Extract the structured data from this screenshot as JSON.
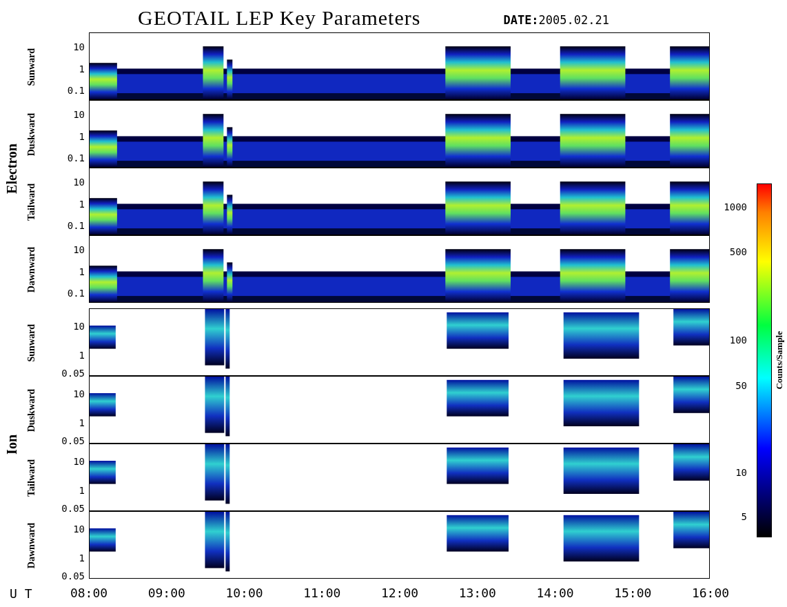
{
  "title": "GEOTAIL LEP Key Parameters",
  "date": "**DATE:**2005.02.21",
  "groups": [
    {
      "name": "Electron",
      "kind": "electron",
      "panels": [
        {
          "label": "Sunward",
          "yticks": [
            "10",
            "1",
            "0.1"
          ]
        },
        {
          "label": "Duskward",
          "yticks": [
            "10",
            "1",
            "0.1"
          ]
        },
        {
          "label": "Tailward",
          "yticks": [
            "10",
            "1",
            "0.1"
          ]
        },
        {
          "label": "Dawnward",
          "yticks": [
            "10",
            "1",
            "0.1"
          ]
        }
      ]
    },
    {
      "name": "Ion",
      "kind": "ion",
      "panels": [
        {
          "label": "Sunward",
          "yticks": [
            "10",
            "1",
            "0.05"
          ]
        },
        {
          "label": "Duskward",
          "yticks": [
            "10",
            "1",
            "0.05"
          ]
        },
        {
          "label": "Tailward",
          "yticks": [
            "10",
            "1",
            "0.05"
          ]
        },
        {
          "label": "Dawnward",
          "yticks": [
            "10",
            "1",
            "0.05"
          ]
        }
      ]
    }
  ],
  "colorbar": {
    "label": "Counts/Sample",
    "ticks": [
      "1000",
      "500",
      "100",
      "50",
      "10",
      "5"
    ]
  },
  "time_axis": {
    "label": "U T",
    "ticks": [
      "08:00",
      "09:00",
      "10:00",
      "11:00",
      "12:00",
      "13:00",
      "14:00",
      "15:00",
      "16:00"
    ]
  }
}
